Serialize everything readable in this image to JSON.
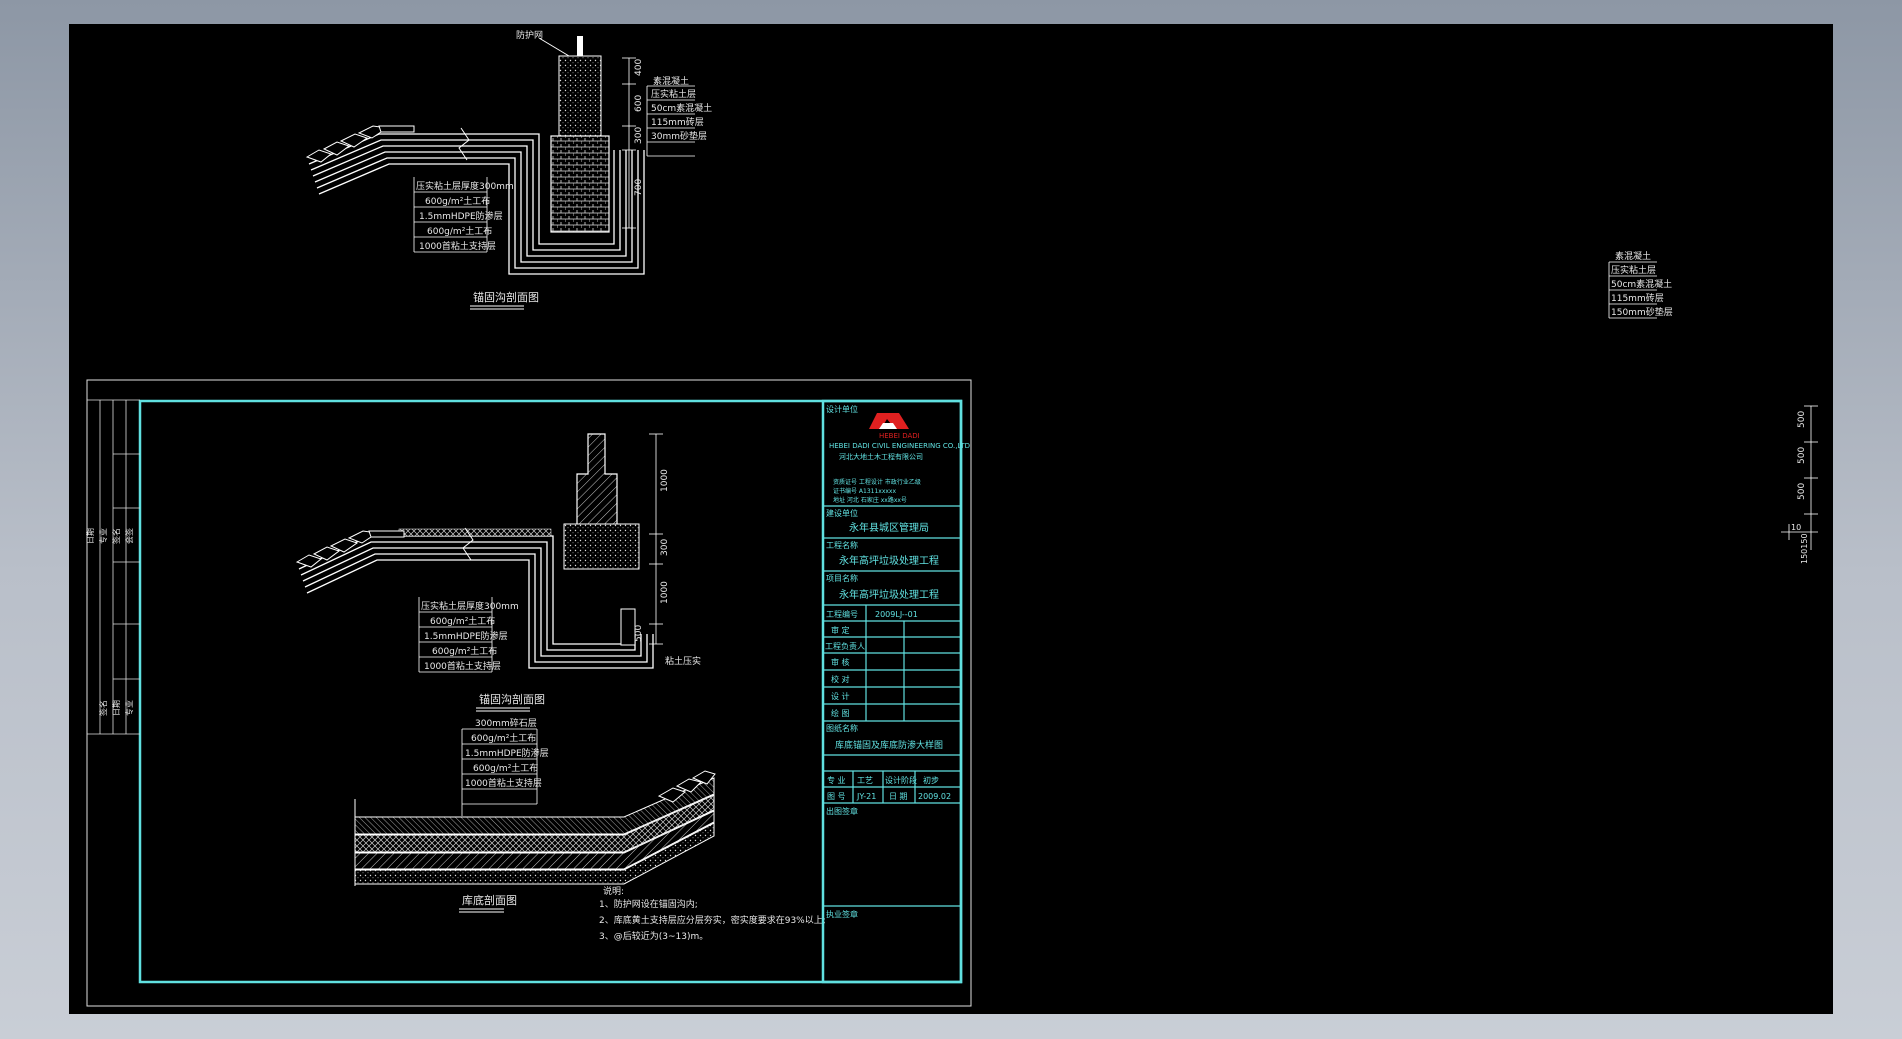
{
  "upper_section": {
    "guard_net_label": "防护网",
    "dims": [
      "400",
      "600",
      "300",
      "700"
    ],
    "right_layers": [
      "素混凝土",
      "压实粘土层",
      "50cm素混凝土",
      "115mm砖层",
      "30mm砂垫层"
    ],
    "liner_layers": [
      "压实粘土层厚度300mm",
      "600g/m²土工布",
      "1.5mmHDPE防渗层",
      "600g/m²土工布",
      "1000首粘土支持层"
    ],
    "title": "锚固沟剖面图"
  },
  "right_legend": [
    "素混凝土",
    "压实粘土层",
    "50cm素混凝土",
    "115mm砖层",
    "150mm砂垫层"
  ],
  "scale_ticks": [
    "500",
    "500",
    "500",
    "10",
    "150150"
  ],
  "sheet": {
    "left_strip": [
      "日期",
      "专业",
      "签名",
      "会签",
      "日期",
      "专业",
      "签名"
    ],
    "anchor_dims": [
      "1000",
      "300",
      "1000",
      "500"
    ],
    "anchor_layers": [
      "压实粘土层厚度300mm",
      "600g/m²土工布",
      "1.5mmHDPE防渗层",
      "600g/m²土工布",
      "1000首粘土支持层"
    ],
    "clay_label": "粘土压实",
    "anchor_title": "锚固沟剖面图",
    "bottom_layers": [
      "300mm碎石层",
      "600g/m²土工布",
      "1.5mmHDPE防渗层",
      "600g/m²土工布",
      "1000首粘土支持层"
    ],
    "bottom_title": "库底剖面图",
    "notes_title": "说明:",
    "notes": [
      "1、防护网设在锚固沟内;",
      "2、库底黄土支持层应分层夯实，密实度要求在93%以上;",
      "3、@后较近为(3~13)m。"
    ],
    "title_block": {
      "design_unit_label": "设计单位",
      "logo_text": "HEBEI DADI",
      "company_en": "HEBEI DADI CIVIL ENGINEERING CO.,LTD",
      "company_cn": "河北大地土木工程有限公司",
      "company_info": [
        "资质证号 工程设计 市政行业乙级",
        "证书编号 A1311xxxxx",
        "地址 河北 石家庄 xx路xx号"
      ],
      "client_label": "建设单位",
      "client": "永年县城区管理局",
      "project_label": "工程名称",
      "project": "永年高坪垃圾处理工程",
      "item_label": "项目名称",
      "item": "永年高坪垃圾处理工程",
      "project_no_label": "工程编号",
      "project_no": "2009LJ--01",
      "roles": [
        "审 定",
        "工程负责人",
        "审 核",
        "校 对",
        "设 计",
        "绘 图"
      ],
      "drawing_name_label": "图纸名称",
      "drawing_name": "库底锚固及库底防渗大样图",
      "row1": [
        "专 业",
        "工艺",
        "设计阶段",
        "初步"
      ],
      "row2": [
        "图 号",
        "JY-21",
        "日 期",
        "2009.02"
      ],
      "stamp_label": "出图签章",
      "reg_stamp_label": "执业签章"
    }
  },
  "colors": {
    "background": "#000000",
    "frame": "#60e0e0",
    "line": "#ffffff",
    "desktop": "#a6aebb"
  }
}
